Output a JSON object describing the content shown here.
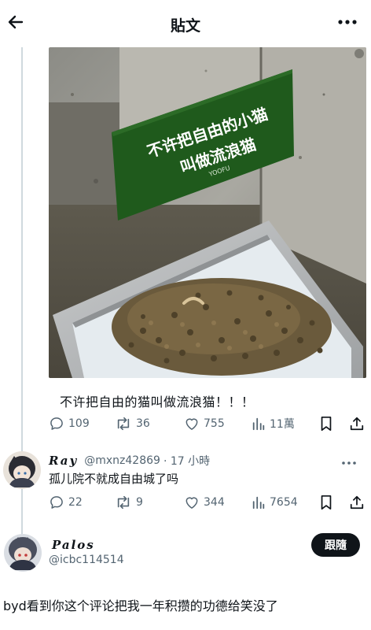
{
  "header": {
    "title": "貼文",
    "back_icon": "arrow-left-icon",
    "more_icon": "more-horizontal-icon"
  },
  "post": {
    "image": {
      "sign_line1": "不许把自由的小猫",
      "sign_line2": "叫做流浪猫",
      "sign_brand": "YOOFU"
    },
    "text": "不许把自由的猫叫做流浪猫！！！",
    "stats": {
      "replies": "109",
      "reposts": "36",
      "likes": "755",
      "views": "11萬"
    }
  },
  "reply": {
    "name": "Ray",
    "handle": "@mxnz42869",
    "time": "· 17 小時",
    "text": "孤儿院不就成自由城了吗",
    "stats": {
      "replies": "22",
      "reposts": "9",
      "likes": "344",
      "views": "7654"
    }
  },
  "quote": {
    "name": "Palos",
    "handle": "@icbc114514",
    "follow_label": "跟隨"
  },
  "body": {
    "text": "byd看到你这个评论把我一年积攒的功德给笑没了"
  },
  "colors": {
    "text_primary": "#0f1419",
    "text_secondary": "#536471",
    "thread_line": "#cfd9de",
    "sign_green": "#1f5a1c",
    "follow_bg": "#0f1419"
  }
}
